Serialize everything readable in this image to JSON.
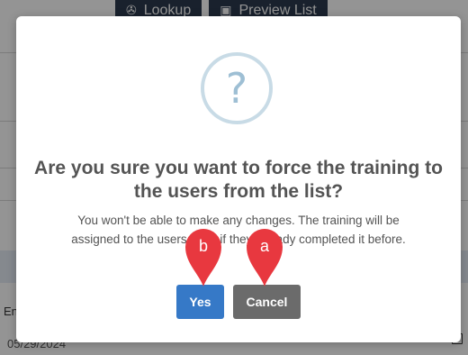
{
  "background": {
    "toolbar": {
      "lookup_label": "Lookup",
      "preview_list_label": "Preview List"
    },
    "field_label": "En",
    "date_value": "05/29/2024"
  },
  "dialog": {
    "icon_glyph": "?",
    "title": "Are you sure you want to force the training to the users from the list?",
    "message": "You won't be able to make any changes. The training will be assigned to the users even if they already completed it before.",
    "yes_label": "Yes",
    "cancel_label": "Cancel"
  },
  "annotations": {
    "marker_b_label": "b",
    "marker_a_label": "a",
    "marker_color": "#e8383f"
  },
  "colors": {
    "yes_button": "#3679c7",
    "cancel_button": "#6b6b6b",
    "question_icon": "#9ebfd4"
  }
}
